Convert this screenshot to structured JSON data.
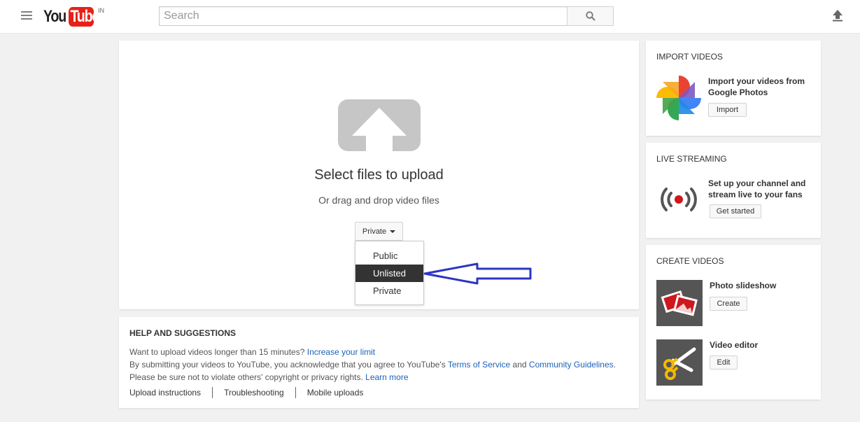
{
  "header": {
    "logo_you": "You",
    "logo_tube": "Tube",
    "logo_country": "IN",
    "search_placeholder": "Search"
  },
  "upload": {
    "title": "Select files to upload",
    "subtitle": "Or drag and drop video files",
    "privacy_selected": "Private",
    "privacy_options": [
      "Public",
      "Unlisted",
      "Private"
    ],
    "highlighted_option": "Unlisted"
  },
  "help": {
    "title": "HELP AND SUGGESTIONS",
    "line1_text": "Want to upload videos longer than 15 minutes?",
    "line1_link": "Increase your limit",
    "line2_text_a": "By submitting your videos to YouTube, you acknowledge that you agree to YouTube's",
    "line2_link_a": "Terms of Service",
    "line2_text_b": "and",
    "line2_link_b": "Community Guidelines",
    "line2_text_c": ".",
    "line3_text": "Please be sure not to violate others' copyright or privacy rights.",
    "line3_link": "Learn more",
    "links": [
      "Upload instructions",
      "Troubleshooting",
      "Mobile uploads"
    ]
  },
  "sidebar": {
    "import": {
      "title": "IMPORT VIDEOS",
      "text": "Import your videos from Google Photos",
      "button": "Import",
      "icon": "google-photos-icon"
    },
    "live": {
      "title": "LIVE STREAMING",
      "text": "Set up your channel and stream live to your fans",
      "button": "Get started",
      "icon": "broadcast-icon",
      "accent": "#cc181e"
    },
    "create": {
      "title": "CREATE VIDEOS",
      "items": [
        {
          "label": "Photo slideshow",
          "button": "Create",
          "icon": "photo-slideshow-icon"
        },
        {
          "label": "Video editor",
          "button": "Edit",
          "icon": "video-editor-icon"
        }
      ]
    }
  },
  "annotation": {
    "arrow_color": "#2b35c4"
  },
  "colors": {
    "brand_red": "#e62117",
    "link_blue": "#1c62b9"
  }
}
